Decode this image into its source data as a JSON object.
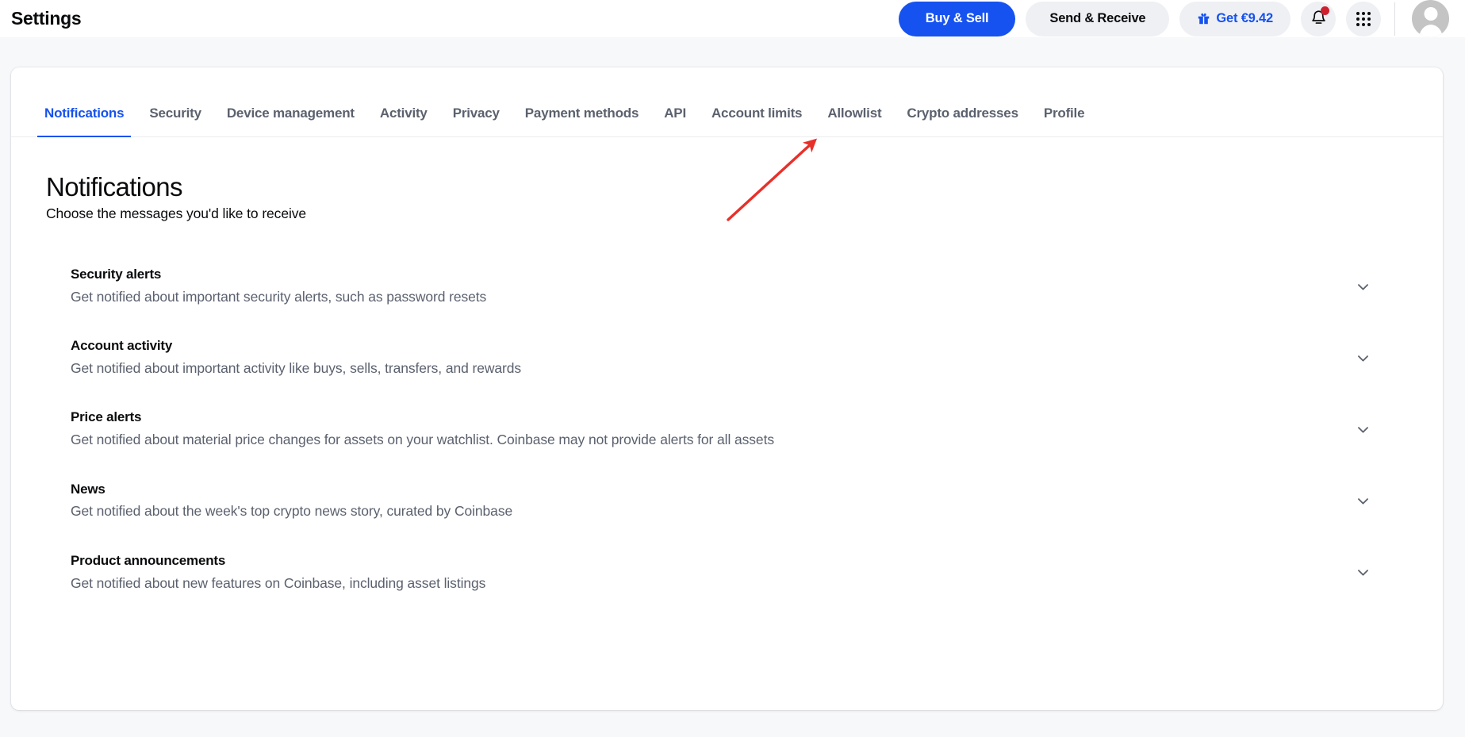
{
  "header": {
    "title": "Settings",
    "buy_sell_label": "Buy & Sell",
    "send_receive_label": "Send & Receive",
    "get_reward_label": "Get €9.42",
    "gift_icon": "gift-icon",
    "bell_icon": "bell-icon",
    "apps_icon": "apps-grid-icon",
    "avatar_icon": "user-avatar-icon",
    "notification_badge": "unread-indicator"
  },
  "tabs": [
    {
      "label": "Notifications",
      "active": true
    },
    {
      "label": "Security",
      "active": false
    },
    {
      "label": "Device management",
      "active": false
    },
    {
      "label": "Activity",
      "active": false
    },
    {
      "label": "Privacy",
      "active": false
    },
    {
      "label": "Payment methods",
      "active": false
    },
    {
      "label": "API",
      "active": false
    },
    {
      "label": "Account limits",
      "active": false
    },
    {
      "label": "Allowlist",
      "active": false
    },
    {
      "label": "Crypto addresses",
      "active": false
    },
    {
      "label": "Profile",
      "active": false
    }
  ],
  "main": {
    "title": "Notifications",
    "subtitle": "Choose the messages you'd like to receive",
    "settings": [
      {
        "label": "Security alerts",
        "description": "Get notified about important security alerts, such as password resets",
        "expand_icon": "chevron-down-icon"
      },
      {
        "label": "Account activity",
        "description": "Get notified about important activity like buys, sells, transfers, and rewards",
        "expand_icon": "chevron-down-icon"
      },
      {
        "label": "Price alerts",
        "description": "Get notified about material price changes for assets on your watchlist. Coinbase may not provide alerts for all assets",
        "expand_icon": "chevron-down-icon"
      },
      {
        "label": "News",
        "description": "Get notified about the week's top crypto news story, curated by Coinbase",
        "expand_icon": "chevron-down-icon"
      },
      {
        "label": "Product announcements",
        "description": "Get notified about new features on Coinbase, including asset listings",
        "expand_icon": "chevron-down-icon"
      }
    ]
  },
  "annotation": {
    "type": "arrow",
    "color": "#e8302a",
    "points_to": "API"
  },
  "colors": {
    "accent": "#1652f0",
    "page_background": "#f7f8fa",
    "card_background": "#ffffff",
    "muted_text": "#5b616e",
    "badge": "#cf202f",
    "pill_secondary": "#eef0f3"
  }
}
